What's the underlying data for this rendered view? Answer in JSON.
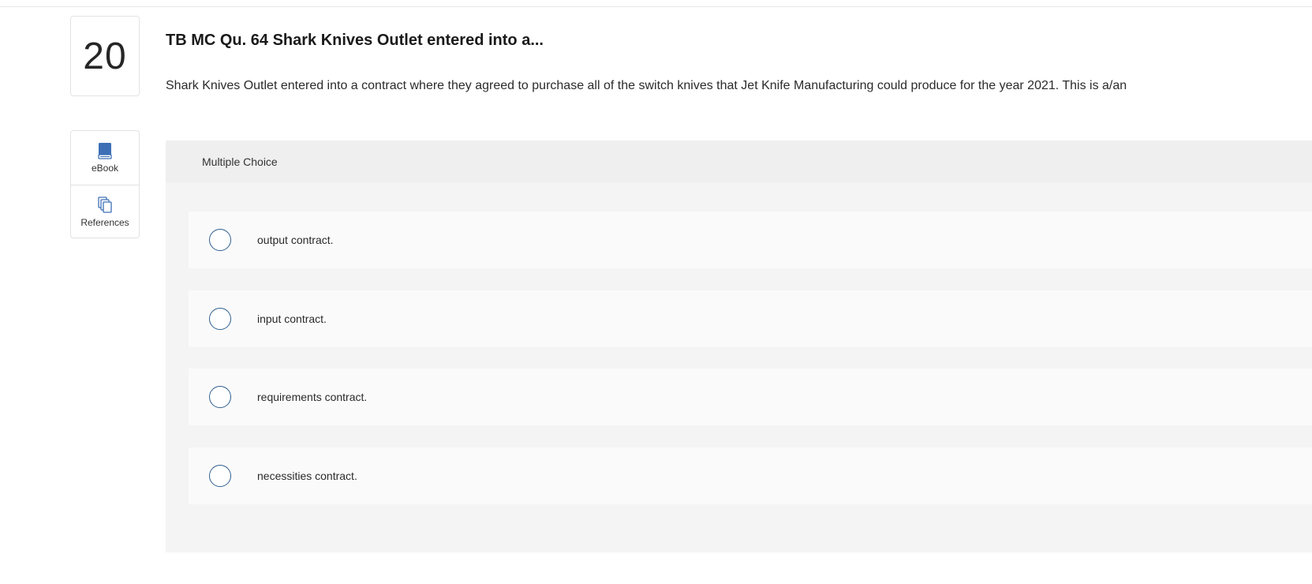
{
  "question": {
    "number": "20",
    "title": "TB MC Qu. 64 Shark Knives Outlet entered into a...",
    "prompt": "Shark Knives Outlet entered into a contract where they agreed to purchase all of the switch knives that Jet Knife Manufacturing could produce for the year 2021. This is a/an"
  },
  "tools": [
    {
      "label": "eBook",
      "icon": "book-icon"
    },
    {
      "label": "References",
      "icon": "copy-pages-icon"
    }
  ],
  "panel": {
    "header": "Multiple Choice",
    "choices": [
      {
        "label": "output contract."
      },
      {
        "label": "input contract."
      },
      {
        "label": "requirements contract."
      },
      {
        "label": "necessities contract."
      }
    ]
  },
  "colors": {
    "accent": "#2f5f8f",
    "icon_blue": "#3d6fb6",
    "panel_bg": "#f4f4f4"
  }
}
